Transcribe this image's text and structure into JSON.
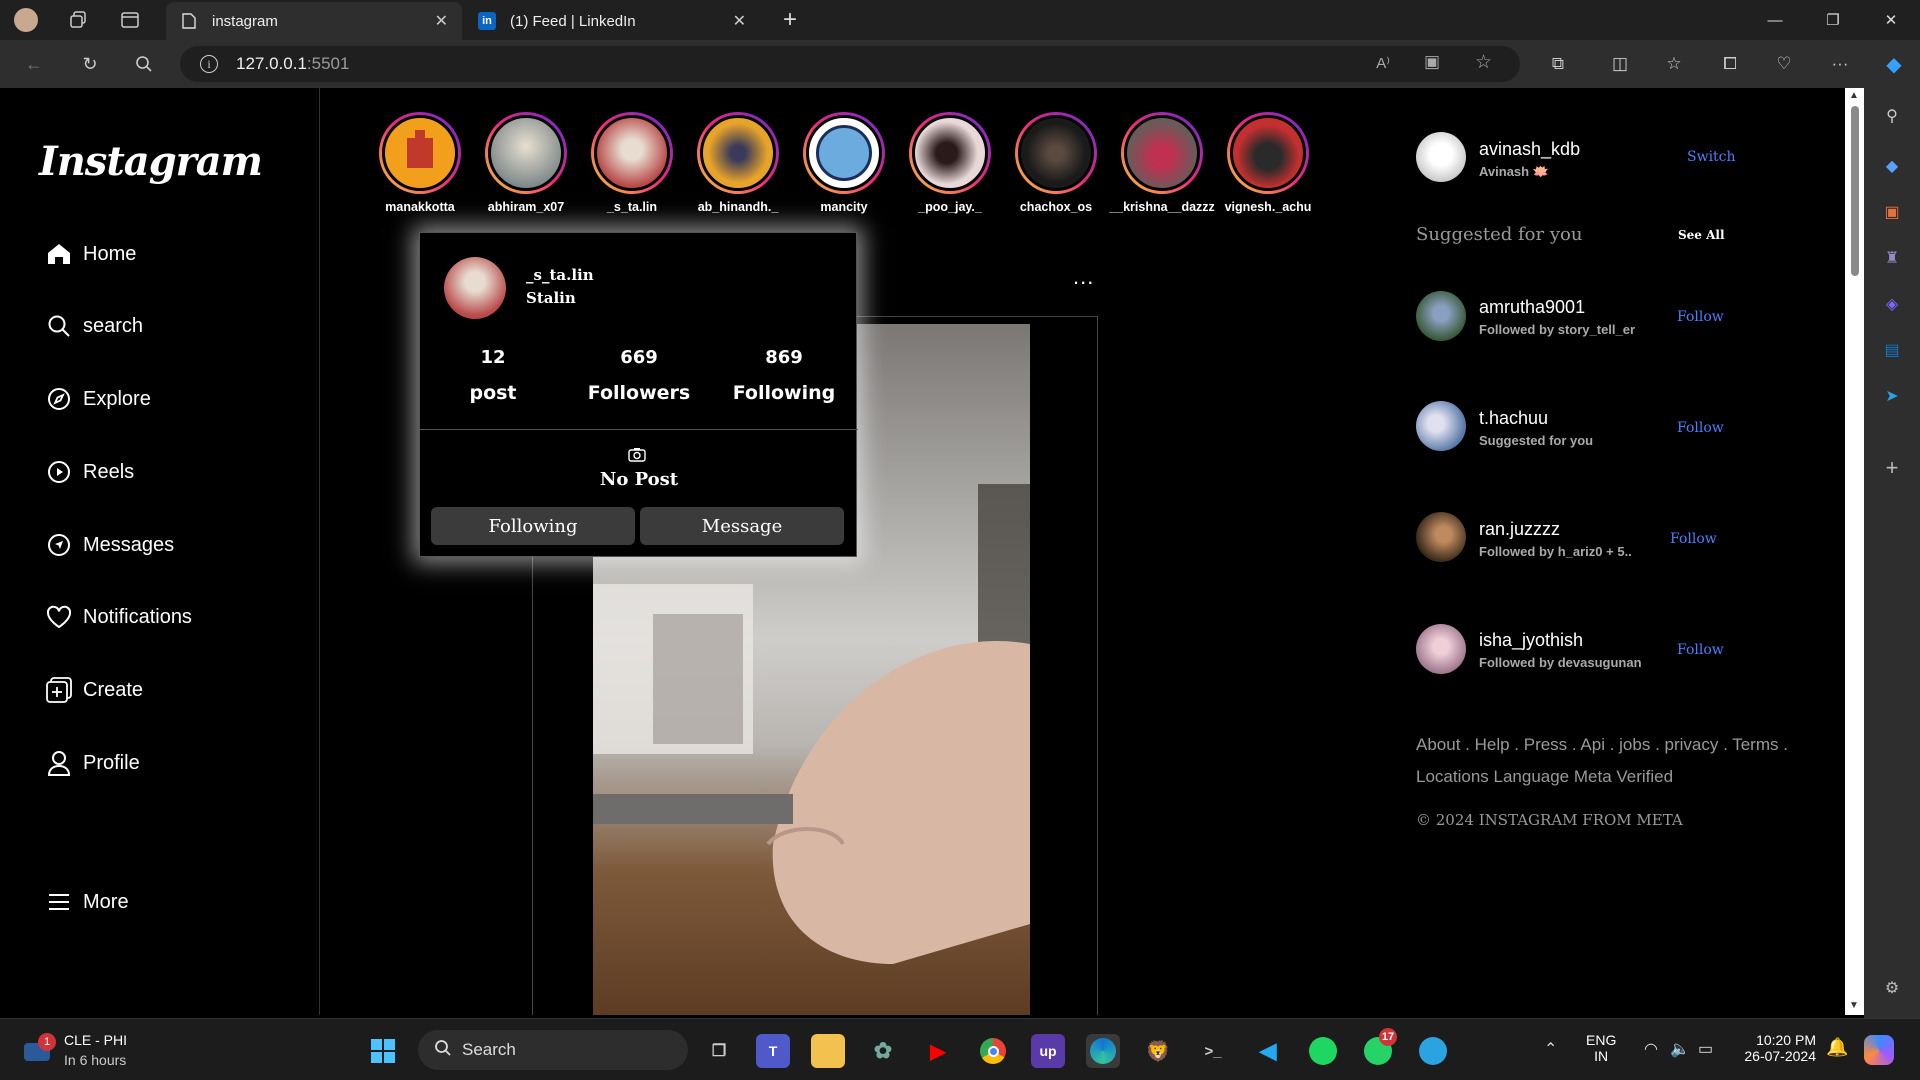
{
  "browser": {
    "tabs": [
      {
        "title": "instagram"
      },
      {
        "title": "(1) Feed | LinkedIn"
      }
    ],
    "url_host": "127.0.0.1",
    "url_port": ":5501"
  },
  "nav": {
    "logo": "Instagram",
    "items": [
      {
        "label": "Home",
        "icon": "home-icon"
      },
      {
        "label": "search",
        "icon": "search-icon"
      },
      {
        "label": "Explore",
        "icon": "compass-icon"
      },
      {
        "label": "Reels",
        "icon": "reels-icon"
      },
      {
        "label": "Messages",
        "icon": "messages-icon"
      },
      {
        "label": "Notifications",
        "icon": "heart-icon"
      },
      {
        "label": "Create",
        "icon": "create-icon"
      },
      {
        "label": "Profile",
        "icon": "profile-icon"
      }
    ],
    "more": "More"
  },
  "stories": [
    {
      "name": "manakkotta",
      "color": "#f2a01c"
    },
    {
      "name": "abhiram_x07",
      "color": "#5a6a72"
    },
    {
      "name": "_s_ta.lin",
      "color": "#b84a4a"
    },
    {
      "name": "ab_hinandh._",
      "color": "#e8a42a"
    },
    {
      "name": "mancity",
      "color": "#6cabdd"
    },
    {
      "name": "_poo_jay._",
      "color": "#b48a9a"
    },
    {
      "name": "chachox_os",
      "color": "#2a2a2a"
    },
    {
      "name": "__krishna__dazzz",
      "color": "#8a3a4a"
    },
    {
      "name": "vignesh._achu",
      "color": "#c43030"
    }
  ],
  "hover_card": {
    "username": "_s_ta.lin",
    "fullname": "Stalin",
    "stats": [
      {
        "num": "12",
        "label": "post"
      },
      {
        "num": "669",
        "label": "Followers"
      },
      {
        "num": "869",
        "label": "Following"
      }
    ],
    "no_post": "No Post",
    "following_btn": "Following",
    "message_btn": "Message"
  },
  "post": {
    "more": "..."
  },
  "sidebar": {
    "me": {
      "username": "avinash_kdb",
      "name": "Avinash 🪷",
      "switch": "Switch"
    },
    "suggested_title": "Suggested for you",
    "see_all": "See All",
    "suggestions": [
      {
        "username": "amrutha9001",
        "sub": "Followed by story_tell_er",
        "follow": "Follow",
        "color": "#3a5a3a"
      },
      {
        "username": "t.hachuu",
        "sub": "Suggested for you",
        "follow": "Follow",
        "color": "#5a7aa8"
      },
      {
        "username": "ran.juzzzz",
        "sub": "Followed by h_ariz0 + 5..",
        "follow": "Follow",
        "color": "#8a5a3a"
      },
      {
        "username": "isha_jyothish",
        "sub": "Followed by devasugunan",
        "follow": "Follow",
        "color": "#a07890"
      }
    ],
    "footer_links": "About . Help . Press . Api . jobs . privacy . Terms . Locations Language Meta Verified",
    "copyright": "© 2024 INSTAGRAM FROM META"
  },
  "taskbar": {
    "weather_title": "CLE - PHI",
    "weather_sub": "In 6 hours",
    "weather_badge": "1",
    "search": "Search",
    "lang1": "ENG",
    "lang2": "IN",
    "time": "10:20 PM",
    "date": "26-07-2024",
    "whatsapp_badge": "17",
    "upwork": "up"
  }
}
